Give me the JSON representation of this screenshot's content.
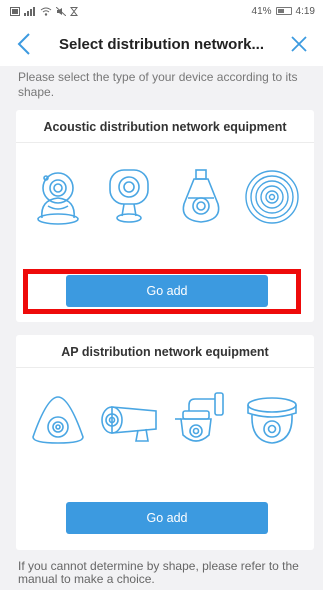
{
  "status_bar": {
    "left_icons": [
      "sim-icon",
      "signal-icon",
      "wifi-icon",
      "mute-icon",
      "hourglass-icon"
    ],
    "battery": "41%",
    "time": "4:19"
  },
  "nav": {
    "title": "Select distribution network...",
    "back_icon": "chevron-left-icon",
    "close_icon": "close-icon"
  },
  "instruction": "Please select the type of your device according to its shape.",
  "acoustic": {
    "title": "Acoustic distribution network equipment",
    "devices": [
      "pan-tilt-camera-icon",
      "cube-camera-icon",
      "bulb-camera-icon",
      "round-speaker-camera-icon"
    ],
    "button_label": "Go add"
  },
  "ap": {
    "title": "AP distribution network equipment",
    "devices": [
      "fisheye-camera-icon",
      "bullet-camera-icon",
      "ptz-dome-camera-icon",
      "dome-camera-icon"
    ],
    "button_label": "Go add"
  },
  "footer_note": "If you cannot determine by shape, please refer to the manual to make a choice.",
  "colors": {
    "accent": "#3c9ae0",
    "highlight": "#ee0a0a",
    "background": "#f2f2f4"
  }
}
